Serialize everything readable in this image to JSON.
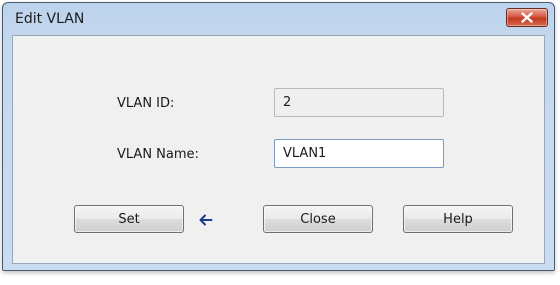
{
  "window": {
    "title": "Edit VLAN"
  },
  "form": {
    "vlan_id_label": "VLAN ID:",
    "vlan_id_value": "2",
    "vlan_name_label": "VLAN Name:",
    "vlan_name_value": "VLAN1"
  },
  "buttons": {
    "set_label": "Set",
    "close_label": "Close",
    "help_label": "Help"
  },
  "icons": {
    "close": "close-x-icon",
    "arrow": "arrow-left-icon"
  },
  "colors": {
    "close_button": "#c2391f",
    "title_bar": "#bcd3ec",
    "client_bg": "#f0f0f0",
    "arrow": "#1f3a8a"
  }
}
